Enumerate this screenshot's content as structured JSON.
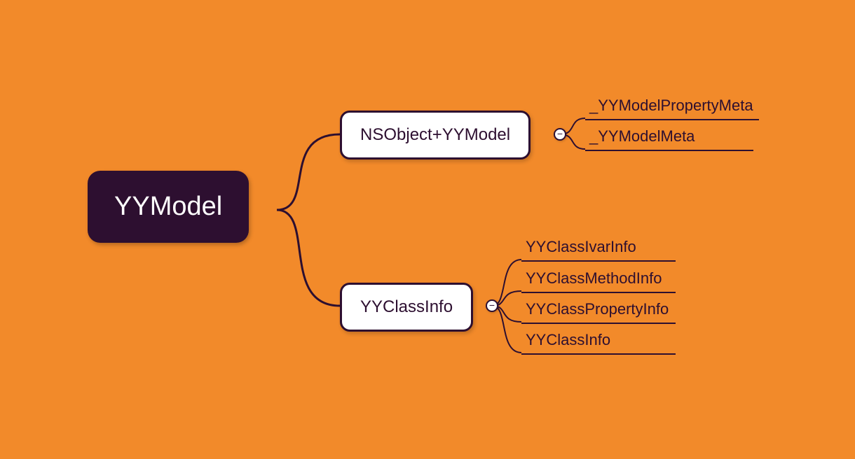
{
  "root": {
    "label": "YYModel"
  },
  "branches": [
    {
      "key": "nsobject",
      "label": "NSObject+YYModel",
      "leaves": [
        {
          "label": "_YYModelPropertyMeta"
        },
        {
          "label": "_YYModelMeta"
        }
      ]
    },
    {
      "key": "classinfo",
      "label": "YYClassInfo",
      "leaves": [
        {
          "label": "YYClassIvarInfo"
        },
        {
          "label": "YYClassMethodInfo"
        },
        {
          "label": "YYClassPropertyInfo"
        },
        {
          "label": "YYClassInfo"
        }
      ]
    }
  ],
  "colors": {
    "bg": "#f28a2a",
    "dark": "#2d0f30",
    "white": "#ffffff"
  },
  "toggle_glyph": "−"
}
